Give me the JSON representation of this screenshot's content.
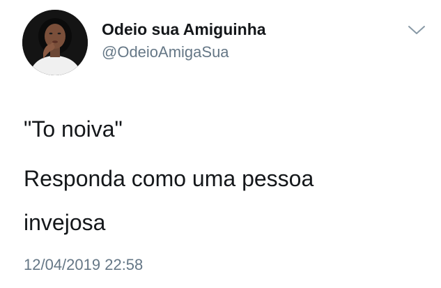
{
  "tweet": {
    "display_name": "Odeio sua Amiguinha",
    "handle": "@OdeioAmigaSua",
    "lines": [
      "\"To noiva\"",
      "Responda como uma pessoa",
      "invejosa"
    ],
    "timestamp": "12/04/2019 22:58"
  },
  "icons": {
    "avatar": "profile-photo",
    "menu": "chevron-down-icon"
  },
  "colors": {
    "text_primary": "#14171a",
    "text_secondary": "#657786",
    "chevron": "#8899a6",
    "background": "#ffffff"
  }
}
